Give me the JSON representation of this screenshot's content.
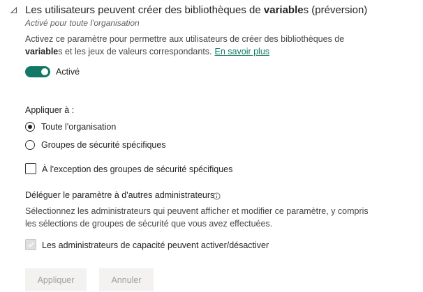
{
  "setting": {
    "title_prefix": "Les utilisateurs peuvent créer des bibliothèques de ",
    "title_bold": "variable",
    "title_suffix": "s (préversion)",
    "subtitle": "Activé pour toute l'organisation",
    "description_line1": "Activez ce paramètre pour permettre aux utilisateurs de créer des bibliothèques de",
    "description_bold": "variable",
    "description_line2_rest": "s et les jeux de valeurs correspondants.",
    "learn_more": "En savoir plus"
  },
  "toggle": {
    "state": "on",
    "label": "Activé",
    "color": "#117865"
  },
  "apply_to": {
    "label": "Appliquer à :",
    "options": [
      {
        "label": "Toute l'organisation",
        "selected": true
      },
      {
        "label": "Groupes de sécurité spécifiques",
        "selected": false
      }
    ],
    "except_label": "À l'exception des groupes de sécurité spécifiques",
    "except_checked": false
  },
  "delegate": {
    "title": "Déléguer le paramètre à d'autres administrateurs",
    "description_line1": "Sélectionnez les administrateurs qui peuvent afficher et modifier ce paramètre, y compris",
    "description_line2": "les sélections de groupes de sécurité que vous avez effectuées.",
    "capacity_admins_label": "Les administrateurs de capacité peuvent activer/désactiver",
    "capacity_admins_checked": true,
    "capacity_admins_disabled": true
  },
  "buttons": {
    "apply": "Appliquer",
    "cancel": "Annuler",
    "disabled": true
  },
  "icons": {
    "collapse": "collapse-triangle-icon",
    "info": "info-icon",
    "check": "checkmark-icon"
  }
}
